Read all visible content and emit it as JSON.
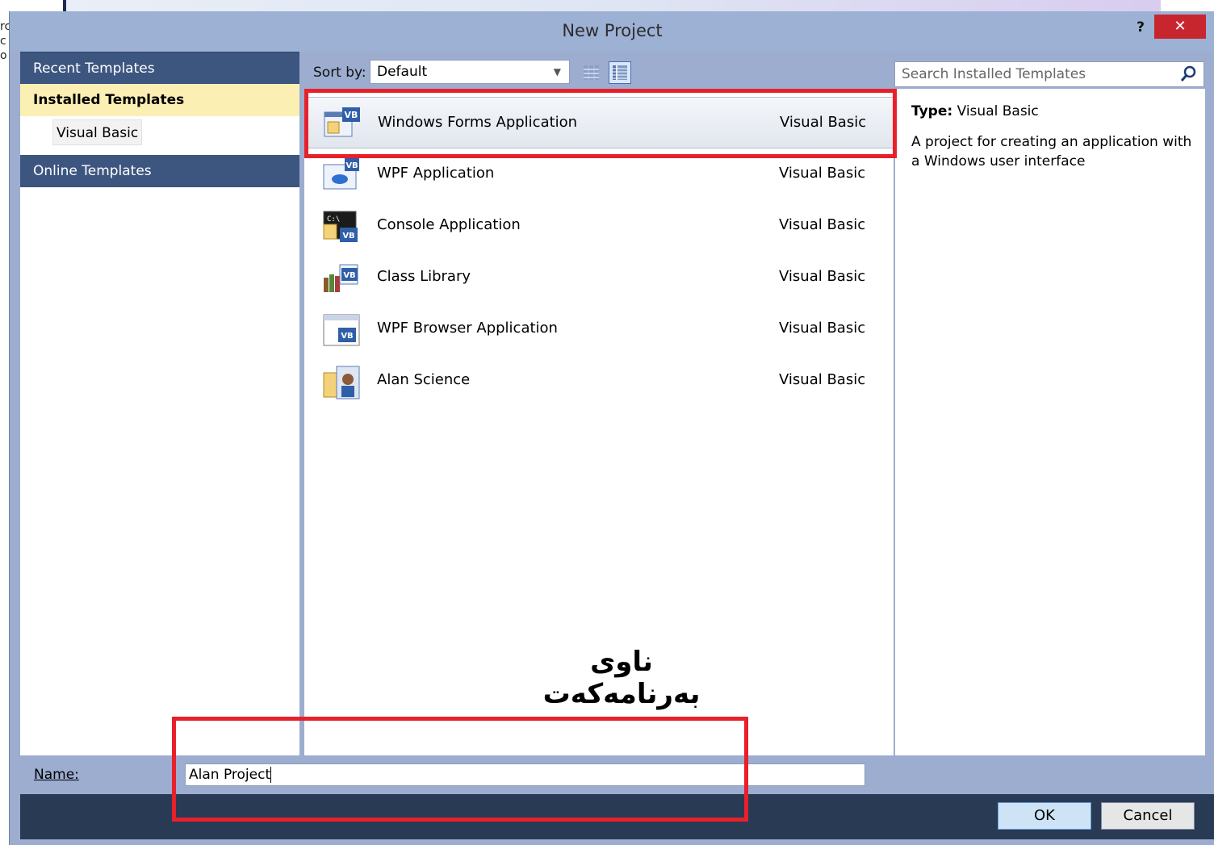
{
  "background": {
    "left_fragment": [
      "rc",
      "c",
      "o"
    ]
  },
  "dialog": {
    "title": "New Project",
    "help_label": "?",
    "close_label": "✕"
  },
  "sidebar": {
    "items": [
      {
        "label": "Recent Templates"
      },
      {
        "label": "Installed Templates",
        "selected": true
      },
      {
        "label": "Visual Basic"
      },
      {
        "label": "Online Templates"
      }
    ]
  },
  "toolbar": {
    "sort_label": "Sort by:",
    "sort_value": "Default",
    "search_placeholder": "Search Installed Templates"
  },
  "templates": [
    {
      "name": "Windows Forms Application",
      "language": "Visual Basic",
      "icon": "winforms-vb-icon",
      "selected": true
    },
    {
      "name": "WPF Application",
      "language": "Visual Basic",
      "icon": "wpf-vb-icon"
    },
    {
      "name": "Console Application",
      "language": "Visual Basic",
      "icon": "console-vb-icon"
    },
    {
      "name": "Class Library",
      "language": "Visual Basic",
      "icon": "class-library-vb-icon"
    },
    {
      "name": "WPF Browser Application",
      "language": "Visual Basic",
      "icon": "wpf-browser-vb-icon"
    },
    {
      "name": "Alan Science",
      "language": "Visual Basic",
      "icon": "alan-science-icon"
    }
  ],
  "details": {
    "type_label": "Type:",
    "type_value": "Visual Basic",
    "description": "A project for creating an application with a Windows user interface"
  },
  "annotation": {
    "label": "ناوی بەرنامەکەت",
    "color": "#e8202a"
  },
  "name_field": {
    "label": "Name:",
    "value": "Alan Project"
  },
  "buttons": {
    "ok": "OK",
    "cancel": "Cancel"
  }
}
